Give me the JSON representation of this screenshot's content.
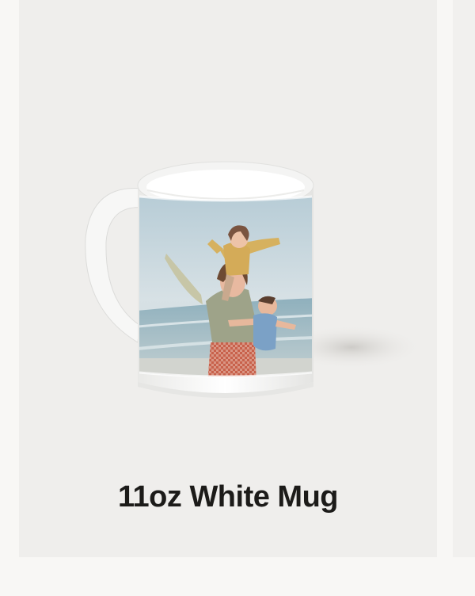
{
  "product": {
    "title": "11oz White Mug",
    "image_icon": "mug-photo-image"
  },
  "colors": {
    "card_background": "#efeeec",
    "page_background": "#f8f7f5",
    "title_text": "#1c1b19"
  }
}
